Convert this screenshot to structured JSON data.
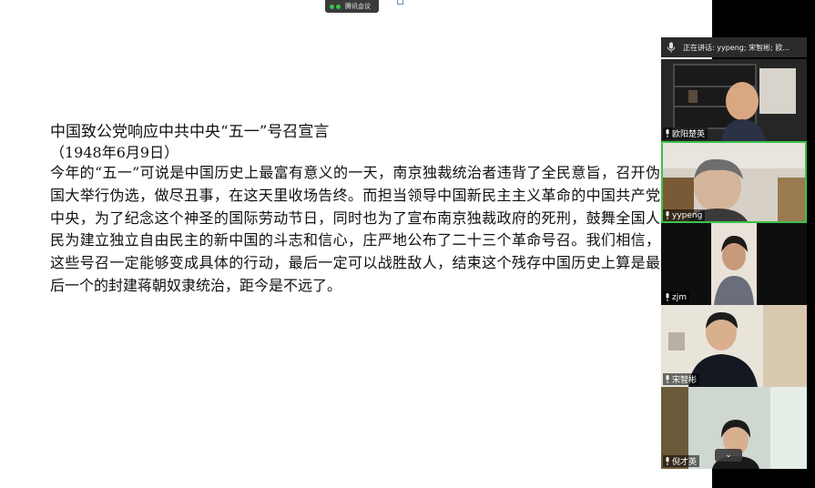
{
  "meeting": {
    "badge_label": "腾讯会议",
    "speaking_text": "正在讲话: yypeng; 宋智彬; 欧..."
  },
  "slide": {
    "title": "中国致公党响应中共中央“五一”号召宣言",
    "date": "（1948年6月9日）",
    "body": "今年的“五一”可说是中国历史上最富有意义的一天，南京独裁统治者违背了全民意旨，召开伪国大举行伪选，做尽丑事，在这天里收场告终。而担当领导中国新民主主义革命的中国共产党中央，为了纪念这个神圣的国际劳动节日，同时也为了宣布南京独裁政府的死刑，鼓舞全国人民为建立独立自由民主的新中国的斗志和信心，庄严地公布了二十三个革命号召。我们相信，这些号召一定能够变成具体的行动，最后一定可以战胜敌人，结束这个残存中国历史上算是最后一个的封建蒋朝奴隶统治，距今是不远了。"
  },
  "participants": [
    {
      "name": "欧阳楚英",
      "speaking": false
    },
    {
      "name": "yypeng",
      "speaking": true
    },
    {
      "name": "zjm",
      "speaking": false
    },
    {
      "name": "宋智彬",
      "speaking": false
    },
    {
      "name": "倪才英",
      "speaking": false
    }
  ],
  "colors": {
    "accent_green": "#3bc24a",
    "panel_bg": "#000000"
  }
}
